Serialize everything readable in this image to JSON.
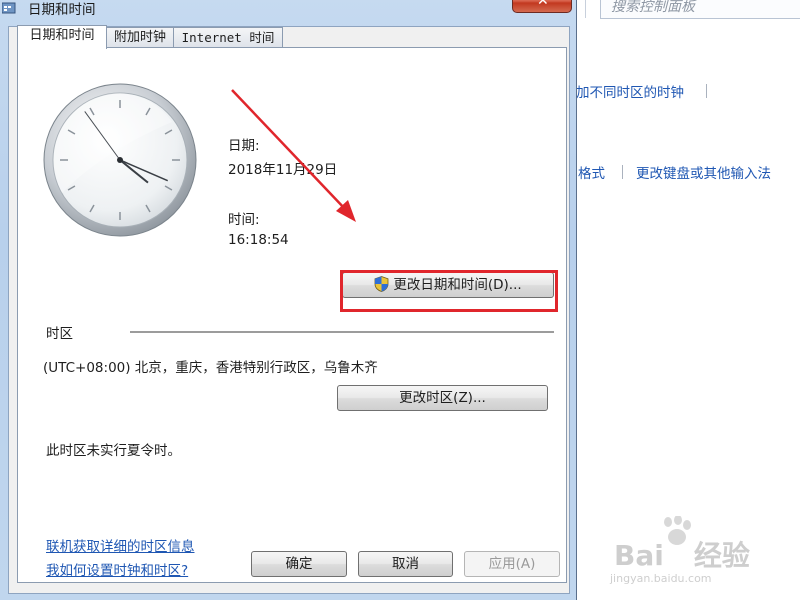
{
  "background": {
    "search_placeholder": "搜索控制面板",
    "link_clock_zones": "加不同时区的时钟",
    "link_format": "格式",
    "link_keyboard": "更改键盘或其他输入法"
  },
  "dialog": {
    "title": "日期和时间",
    "close_symbol": "✕",
    "tabs": [
      "日期和时间",
      "附加时钟",
      "Internet 时间"
    ],
    "date_label": "日期:",
    "date_value": "2018年11月29日",
    "time_label": "时间:",
    "time_value": "16:18:54",
    "change_datetime_button": "更改日期和时间(D)...",
    "timezone_heading": "时区",
    "timezone_value": "(UTC+08:00) 北京，重庆，香港特别行政区，乌鲁木齐",
    "change_timezone_button": "更改时区(Z)...",
    "dst_note": "此时区未实行夏令时。",
    "link_online_info": "联机获取详细的时区信息",
    "link_how_to": "我如何设置时钟和时区?",
    "ok_button": "确定",
    "cancel_button": "取消",
    "apply_button": "应用(A)"
  },
  "clock": {
    "hours": 16,
    "minutes": 18,
    "seconds": 54
  },
  "watermark": {
    "brand": "Bai",
    "brand_suffix": "经验",
    "site": "jingyan.baidu.com"
  },
  "colors": {
    "highlight": "#e0262c",
    "link": "#1f57b3",
    "title_bar": "#c6daf0"
  }
}
